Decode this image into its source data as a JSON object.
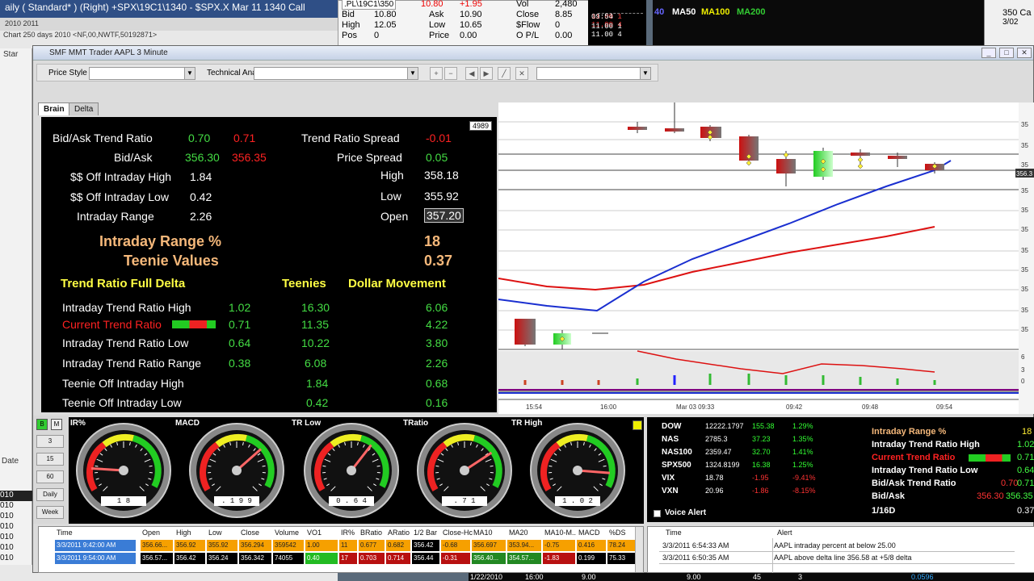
{
  "bg_left": {
    "title": "aily     ( Standard*   )   (Right)     +SPX\\19C1\\1340 - $SPX.X  Mar 11  1340 Call",
    "subtitle": "2010          2011",
    "chart_title": "Chart 250 days 2010 <NF,00,NWTF,50192871>",
    "star_label": "Star",
    "date_label": "Date",
    "rows": [
      "010",
      "010",
      "010",
      "010",
      "010",
      "010",
      "010"
    ]
  },
  "bg_quote": {
    "symbol": ".PL\\19C1\\350",
    "last": "10.80",
    "change": "+1.95",
    "bid_label": "Bid",
    "bid": "10.80",
    "ask_label": "Ask",
    "ask": "10.90",
    "high_label": "High",
    "high": "12.05",
    "low_label": "Low",
    "low": "10.65",
    "pos_label": "Pos",
    "pos": "0",
    "price_label": "Price",
    "price": "0.00",
    "vol_label": "Vol",
    "vol": "2,480",
    "close_label": "Close",
    "close": "8.85",
    "sflow_label": "$Flow",
    "sflow": "0",
    "opl_label": "O P/L",
    "opl": "0.00"
  },
  "bg_tape": {
    "rows": [
      "11.00 1",
      "11.00 4",
      "09:54",
      "11.00 1",
      "11.00 4"
    ]
  },
  "bg_chart_top": {
    "ma_labels": [
      "40",
      "MA50",
      "MA100",
      "MA200"
    ]
  },
  "bg_right": {
    "line1": "350 Ca",
    "line2": "3/02"
  },
  "main": {
    "title": "SMF MMT Trader AAPL  3 Minute",
    "price_style_label": "Price Style",
    "technical_analysis_label": "Technical Analysis"
  },
  "tabs": [
    "Brain",
    "Delta"
  ],
  "brain": {
    "count": "4989",
    "bidask_ratio_label": "Bid/Ask Trend Ratio",
    "bidask_ratio_a": "0.70",
    "bidask_ratio_b": "0.71",
    "trend_spread_label": "Trend Ratio Spread",
    "trend_spread": "-0.01",
    "bidask_label": "Bid/Ask",
    "bid": "356.30",
    "ask": "356.35",
    "price_spread_label": "Price Spread",
    "price_spread": "0.05",
    "off_high_label": "$$ Off Intraday High",
    "off_high": "1.84",
    "high_label": "High",
    "high": "358.18",
    "off_low_label": "$$ Off Intraday Low",
    "off_low": "0.42",
    "low_label": "Low",
    "low": "355.92",
    "range_label": "Intraday Range",
    "range": "2.26",
    "open_label": "Open",
    "open": "357.20",
    "range_pct_label": "Intraday Range %",
    "range_pct": "18",
    "teenie_label": "Teenie Values",
    "teenie": "0.37",
    "delta_header": "Trend Ratio Full Delta",
    "teenies_header": "Teenies",
    "dollar_header": "Dollar Movement",
    "rows": [
      {
        "label": "Intraday Trend Ratio High",
        "a": "1.02",
        "b": "16.30",
        "c": "6.06"
      },
      {
        "label": "Current Trend Ratio",
        "a": "0.71",
        "b": "11.35",
        "c": "4.22"
      },
      {
        "label": "Intraday Trend Ratio Low",
        "a": "0.64",
        "b": "10.22",
        "c": "3.80"
      },
      {
        "label": "Intraday Trend Ratio Range",
        "a": "0.38",
        "b": "6.08",
        "c": "2.26"
      },
      {
        "label": "Teenie Off Intraday High",
        "a": "",
        "b": "1.84",
        "c": "0.68"
      },
      {
        "label": "Teenie Off Intraday Low",
        "a": "",
        "b": "0.42",
        "c": "0.16"
      }
    ]
  },
  "chart": {
    "x_labels": [
      "15:54",
      "16:00",
      "Mar 03 09:33",
      "09:42",
      "09:48",
      "09:54"
    ],
    "price_tag": "356.3",
    "y_labels": [
      "35",
      "35",
      "35",
      "35",
      "35",
      "35",
      "35",
      "35",
      "35",
      "35",
      "35",
      "6",
      "3",
      "0"
    ]
  },
  "gauges": {
    "timeframes": [
      "B",
      "M",
      "3",
      "15",
      "60",
      "Daily",
      "Week"
    ],
    "items": [
      {
        "label": "IR%",
        "value": "1 8",
        "reading": 0.18
      },
      {
        "label": "MACD",
        "value": ". 1 9 9",
        "reading": 0.68
      },
      {
        "label": "TR Low",
        "value": "0 . 6 4",
        "reading": 0.64
      },
      {
        "label": "TRatio",
        "value": ". 7 1",
        "reading": 0.71
      },
      {
        "label": "TR High",
        "value": "1 . 0 2",
        "reading": 0.85
      }
    ]
  },
  "market": {
    "rows": [
      {
        "sym": "DOW",
        "last": "12222.1797",
        "chg": "155.38",
        "pct": "1.29%",
        "neg": false
      },
      {
        "sym": "NAS",
        "last": "2785.3",
        "chg": "37.23",
        "pct": "1.35%",
        "neg": false
      },
      {
        "sym": "NAS100",
        "last": "2359.47",
        "chg": "32.70",
        "pct": "1.41%",
        "neg": false
      },
      {
        "sym": "SPX500",
        "last": "1324.8199",
        "chg": "16.38",
        "pct": "1.25%",
        "neg": false
      },
      {
        "sym": "VIX",
        "last": "18.78",
        "chg": "-1.95",
        "pct": "-9.41%",
        "neg": true
      },
      {
        "sym": "VXN",
        "last": "20.96",
        "chg": "-1.86",
        "pct": "-8.15%",
        "neg": true
      }
    ],
    "voice_alert": "Voice Alert",
    "intraday": [
      {
        "label": "Intraday Range %",
        "a": "",
        "b": "18",
        "style": "orange"
      },
      {
        "label": "Intraday Trend Ratio High",
        "a": "",
        "b": "1.02",
        "style": "white"
      },
      {
        "label": "Current Trend Ratio",
        "a": "",
        "b": "0.71",
        "style": "red"
      },
      {
        "label": "Intraday Trend Ratio Low",
        "a": "",
        "b": "0.64",
        "style": "white"
      },
      {
        "label": "Bid/Ask Trend Ratio",
        "a": "0.70",
        "b": "0.71",
        "style": "white"
      },
      {
        "label": "Bid/Ask",
        "a": "356.30",
        "b": "356.35",
        "style": "white"
      },
      {
        "label": "1/16D",
        "a": "",
        "b": "0.37",
        "style": "white"
      }
    ]
  },
  "grid": {
    "headers": [
      "Time",
      "Open",
      "High",
      "Low",
      "Close",
      "Volume",
      "VO1",
      "IR%",
      "BRatio",
      "ARatio",
      "1/2 Bar",
      "Close-Hc",
      "MA10",
      "MA20",
      "MA10-M..",
      "MACD",
      "%DS"
    ],
    "rows": [
      [
        "3/3/2011 9:42:00 AM",
        "356.66...",
        "356.92",
        "355.92",
        "356.294",
        "359542",
        "1.00",
        "11",
        "0.677",
        "0.682",
        "356.42",
        "-0.68",
        "356.697",
        "353.94...",
        "-0.75",
        "0.416",
        "78.24"
      ],
      [
        "3/3/2011 9:54:00 AM",
        "356.57...",
        "356.42",
        "356.24",
        "356.342",
        "74055",
        "0.40",
        "17",
        "0.703",
        "0.714",
        "356.44",
        "-0.31",
        "356.40...",
        "354.57...",
        "-1.83",
        "0.199",
        "75.33"
      ]
    ]
  },
  "alerts": {
    "headers": [
      "Time",
      "Alert"
    ],
    "rows": [
      [
        "3/3/2011 6:54:33 AM",
        "AAPL intraday percent at below 25.00"
      ],
      [
        "3/3/2011 6:50:35 AM",
        "AAPL above delta line 356.58 at +5/8 delta"
      ]
    ]
  },
  "bottom_strip": {
    "items": [
      "1/22/2010",
      "16:00",
      "9.00",
      "9.00",
      "45",
      "3",
      "0.0596"
    ]
  },
  "colors": {
    "green": "#44dd44",
    "red": "#ff2222",
    "orange": "#f5b87a",
    "yellow": "#ffee33",
    "blue_series": "#1a2fd0",
    "red_series": "#dd1111"
  }
}
